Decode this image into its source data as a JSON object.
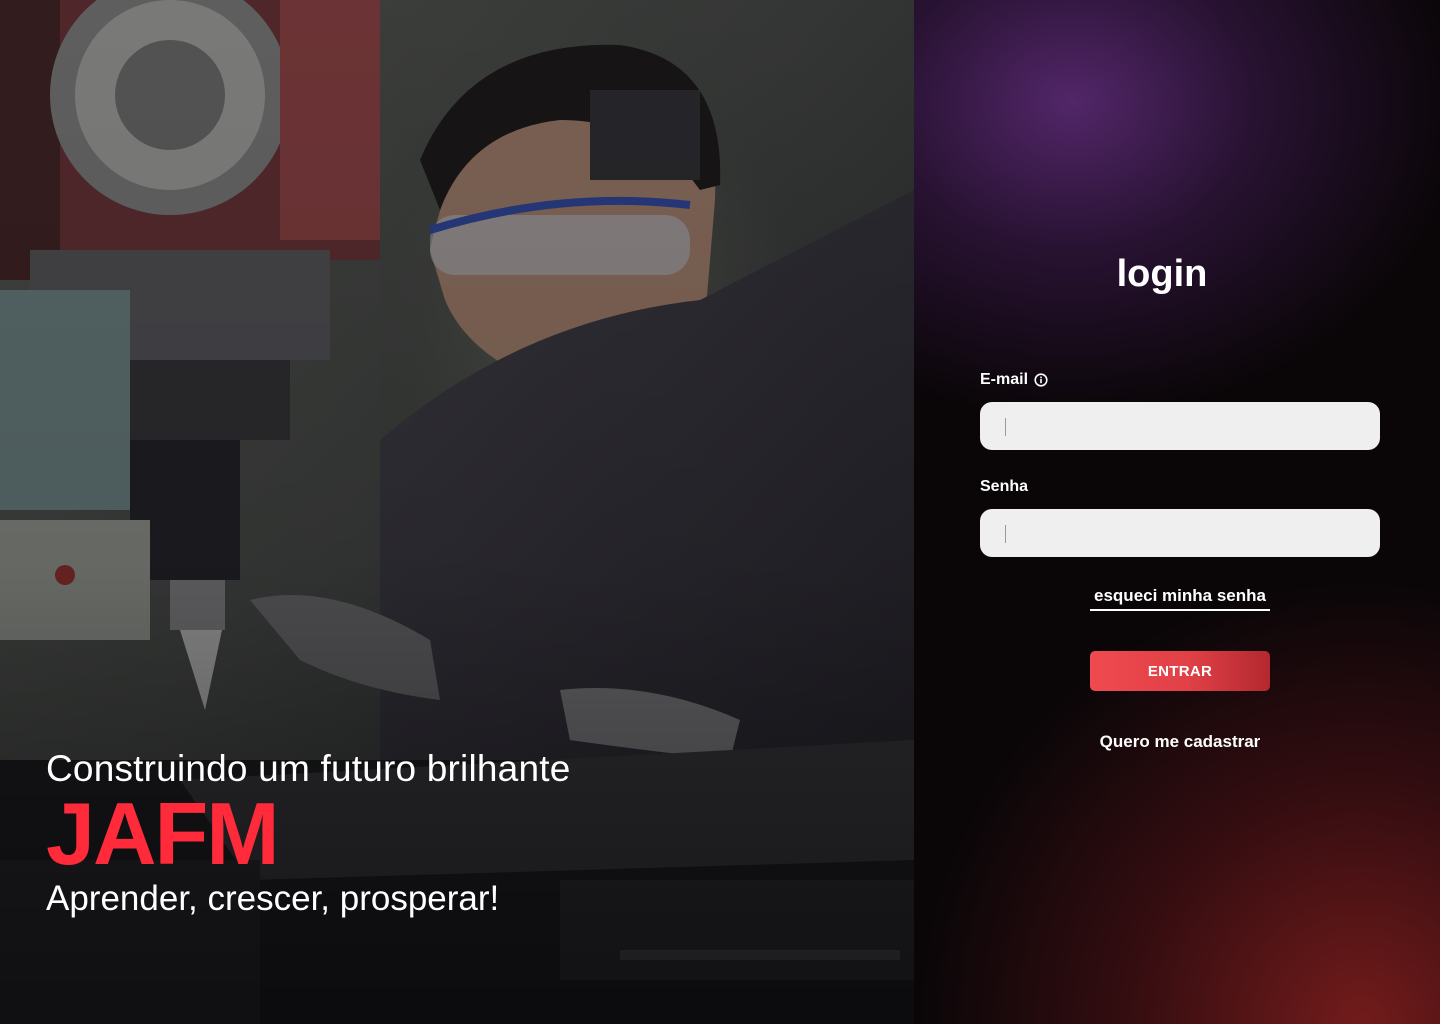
{
  "hero": {
    "subtitle": "Construindo um futuro brilhante",
    "brand": "JAFM",
    "tagline": "Aprender, crescer, prosperar!",
    "brand_color": "#ff2a3a"
  },
  "login": {
    "title": "login",
    "email_label": "E-mail",
    "email_value": "",
    "email_info_icon": "info-icon",
    "password_label": "Senha",
    "password_value": "",
    "forgot_password": "esqueci minha senha",
    "submit_label": "ENTRAR",
    "register_label": "Quero me cadastrar",
    "accent_color": "#e8454b"
  }
}
